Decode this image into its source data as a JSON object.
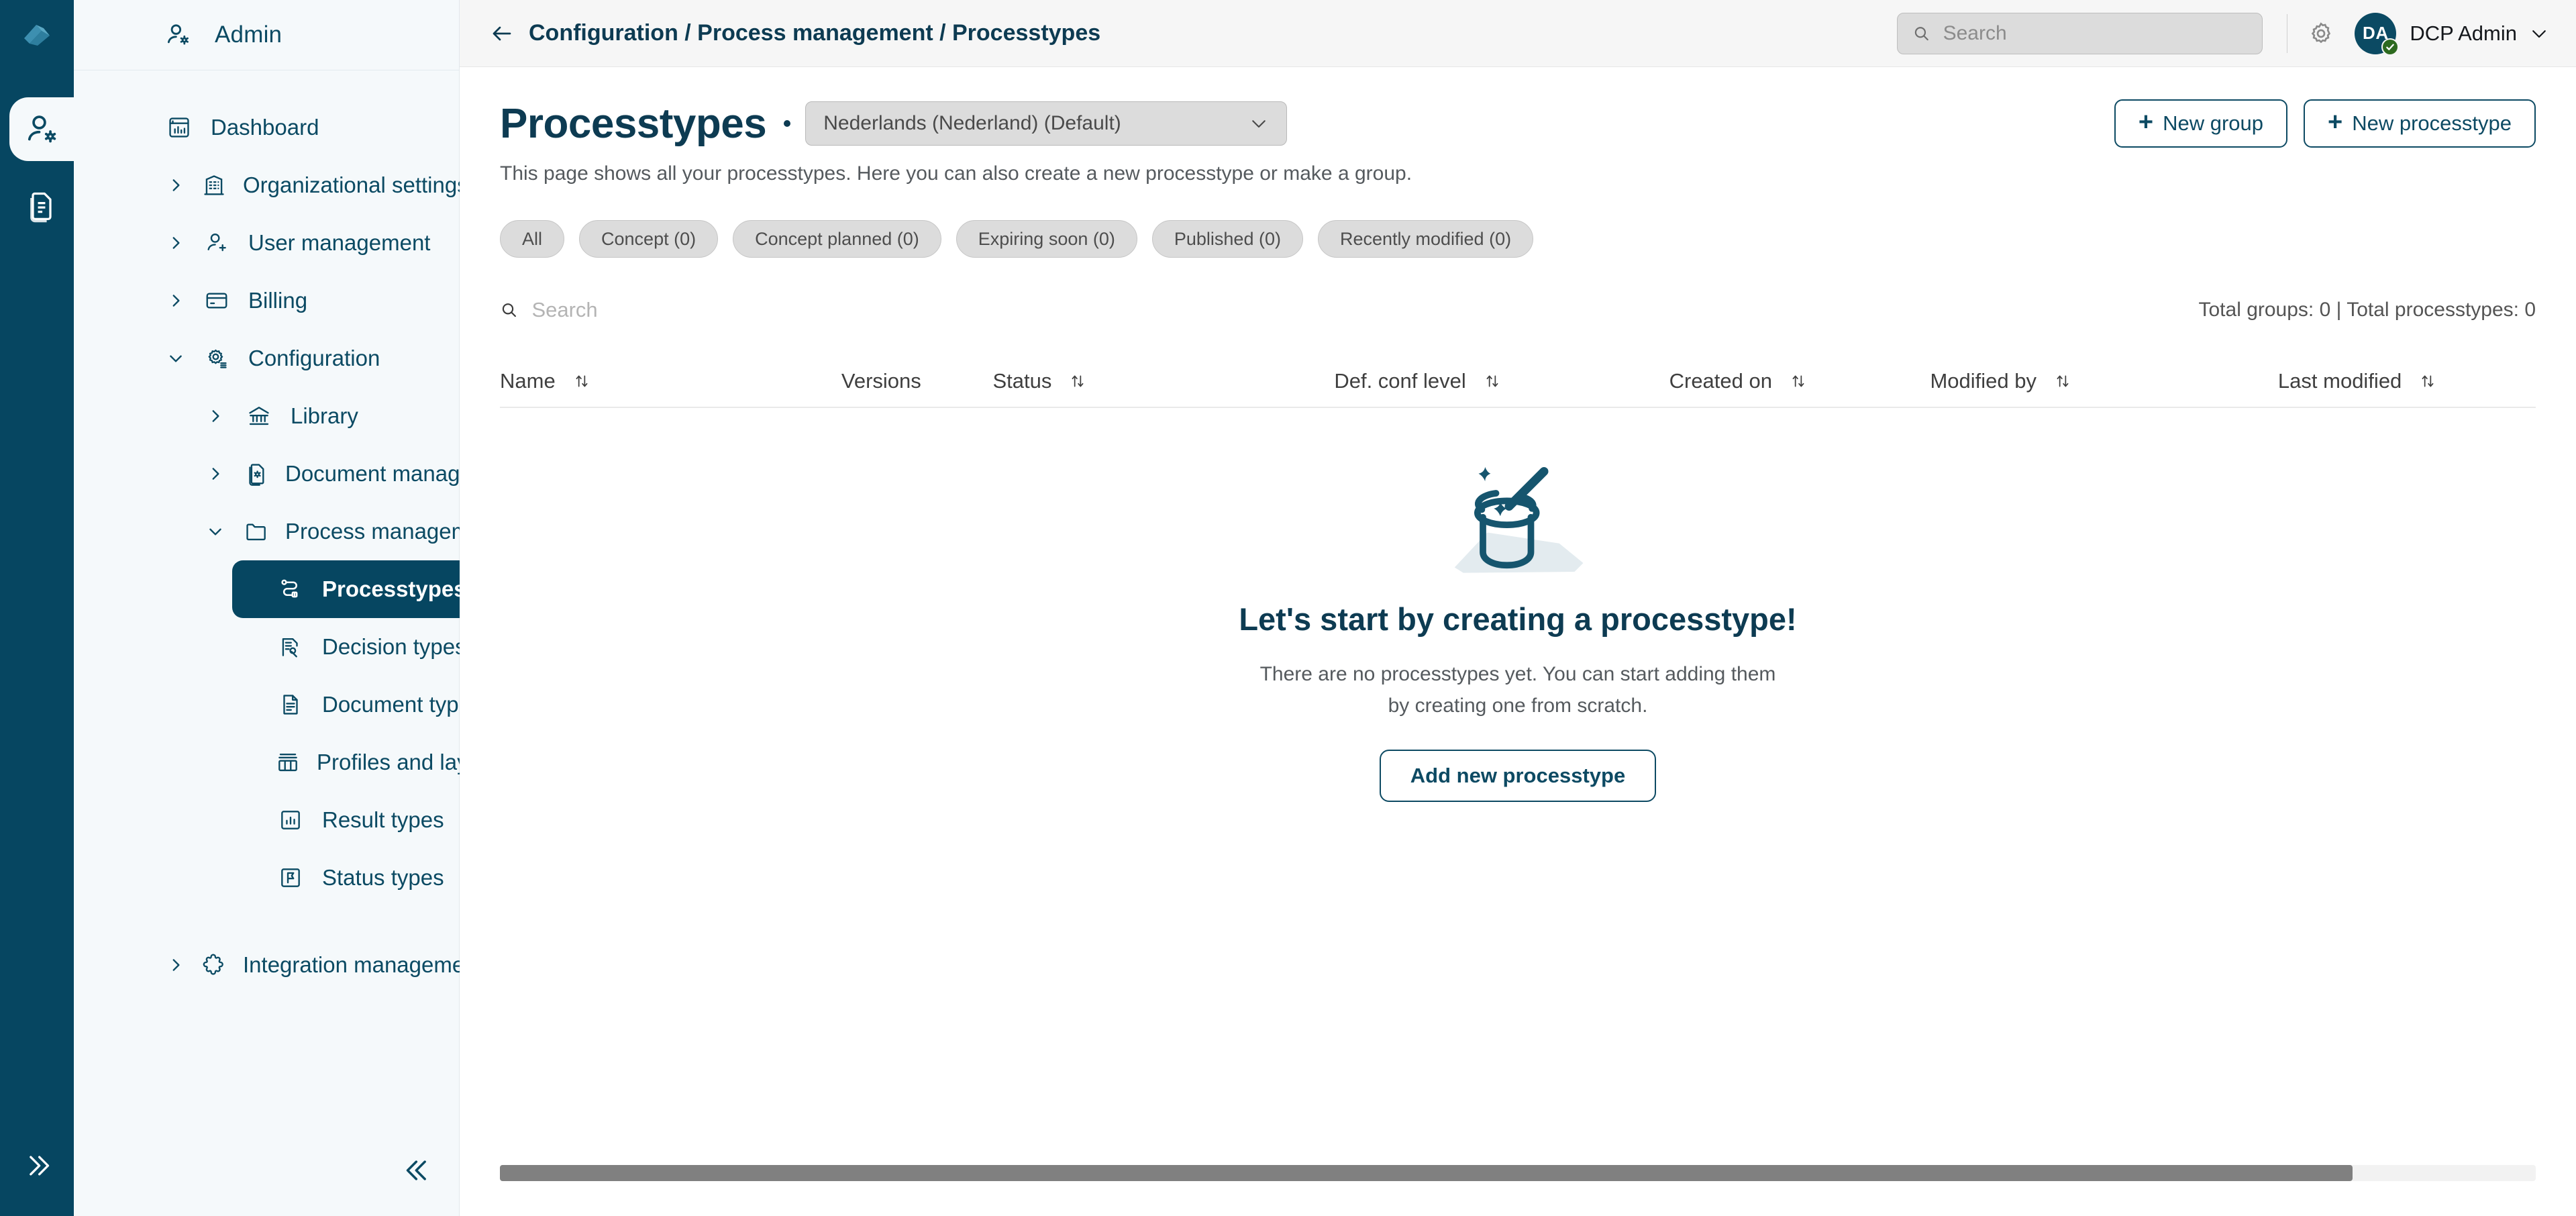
{
  "rail": {
    "logo_icon": "app-logo-icon",
    "items": [
      {
        "icon": "user-settings-icon",
        "name": "admin",
        "active": true
      },
      {
        "icon": "document-copy-icon",
        "name": "documents",
        "active": false
      }
    ],
    "expand_icon": "chevrons-right-icon"
  },
  "sidebar": {
    "header": {
      "label": "Admin",
      "icon": "user-settings-icon"
    },
    "collapse_icon": "chevrons-left-icon",
    "items": [
      {
        "label": "Dashboard",
        "icon": "dashboard-icon",
        "level": 1,
        "chevron": "none"
      },
      {
        "label": "Organizational settings",
        "icon": "building-icon",
        "level": 1,
        "chevron": "right"
      },
      {
        "label": "User management",
        "icon": "user-add-icon",
        "level": 1,
        "chevron": "right"
      },
      {
        "label": "Billing",
        "icon": "card-icon",
        "level": 1,
        "chevron": "right"
      },
      {
        "label": "Configuration",
        "icon": "gear-list-icon",
        "level": 1,
        "chevron": "down"
      },
      {
        "label": "Library",
        "icon": "library-icon",
        "level": 2,
        "chevron": "right"
      },
      {
        "label": "Document management",
        "icon": "document-gear-icon",
        "level": 2,
        "chevron": "right"
      },
      {
        "label": "Process management",
        "icon": "folder-icon",
        "level": 2,
        "chevron": "down"
      },
      {
        "label": "Processtypes",
        "icon": "process-flow-icon",
        "level": 3,
        "chevron": "none",
        "active": true
      },
      {
        "label": "Decision types",
        "icon": "decision-icon",
        "level": 3,
        "chevron": "none"
      },
      {
        "label": "Document types",
        "icon": "document-text-icon",
        "level": 3,
        "chevron": "none"
      },
      {
        "label": "Profiles and layout",
        "icon": "layout-columns-icon",
        "level": 3,
        "chevron": "none"
      },
      {
        "label": "Result types",
        "icon": "chart-box-icon",
        "level": 3,
        "chevron": "none"
      },
      {
        "label": "Status types",
        "icon": "flag-box-icon",
        "level": 3,
        "chevron": "none"
      },
      {
        "label": "Integration management",
        "icon": "puzzle-icon",
        "level": 1,
        "chevron": "right"
      }
    ]
  },
  "topbar": {
    "back_icon": "arrow-left-icon",
    "breadcrumb": "Configuration / Process management / Processtypes",
    "search": {
      "placeholder": "Search",
      "value": "",
      "icon": "search-icon"
    },
    "gear_icon": "gear-icon",
    "user": {
      "initials": "DA",
      "name": "DCP Admin",
      "badge_icon": "check-icon",
      "caret_icon": "chevron-down-icon"
    }
  },
  "page": {
    "title": "Processtypes",
    "language": {
      "value": "Nederlands (Nederland) (Default)",
      "caret_icon": "chevron-down-icon"
    },
    "actions": [
      {
        "label": "New group",
        "icon": "plus-icon",
        "name": "new-group-button"
      },
      {
        "label": "New processtype",
        "icon": "plus-icon",
        "name": "new-processtype-button"
      }
    ],
    "subtitle": "This page shows all your processtypes. Here you can also create a new processtype or make a group.",
    "filters": [
      {
        "label": "All",
        "name": "filter-all"
      },
      {
        "label": "Concept (0)",
        "name": "filter-concept"
      },
      {
        "label": "Concept planned (0)",
        "name": "filter-concept-planned"
      },
      {
        "label": "Expiring soon (0)",
        "name": "filter-expiring-soon"
      },
      {
        "label": "Published (0)",
        "name": "filter-published"
      },
      {
        "label": "Recently modified (0)",
        "name": "filter-recently-modified"
      }
    ],
    "search": {
      "placeholder": "Search",
      "value": "",
      "icon": "search-icon"
    },
    "totals": "Total groups: 0 | Total processtypes: 0",
    "table": {
      "columns": [
        {
          "label": "Name",
          "sortable": true,
          "key": "c-name"
        },
        {
          "label": "Versions",
          "sortable": false,
          "key": "c-versions"
        },
        {
          "label": "Status",
          "sortable": true,
          "key": "c-status"
        },
        {
          "label": "Def. conf level",
          "sortable": true,
          "key": "c-conf"
        },
        {
          "label": "Created on",
          "sortable": true,
          "key": "c-created"
        },
        {
          "label": "Modified by",
          "sortable": true,
          "key": "c-modby"
        },
        {
          "label": "Last modified",
          "sortable": true,
          "key": "c-last"
        }
      ],
      "rows": []
    },
    "empty_state": {
      "illustration": "magic-hat-wand-icon",
      "title": "Let's start by creating a processtype!",
      "line1": "There are no processtypes yet. You can start adding them",
      "line2": "by creating one from scratch.",
      "button": "Add new processtype"
    }
  },
  "colors": {
    "brand_dark": "#064661",
    "brand_text": "#0d3b52",
    "sidebar_bg": "#f5f9fb",
    "topbar_bg": "#f6f6f6",
    "chip_bg": "#dcdcdc",
    "badge_green": "#2d6a1f"
  }
}
